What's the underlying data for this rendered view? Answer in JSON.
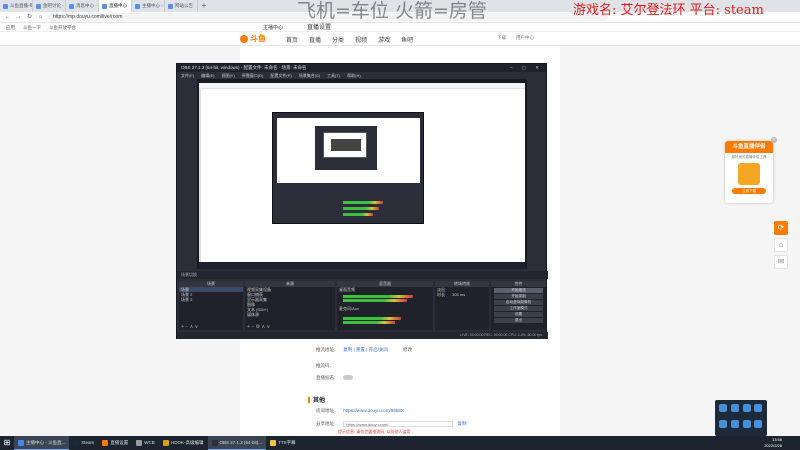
{
  "browser": {
    "tabs": [
      {
        "label": "斗鱼直播-每个人的直播平台"
      },
      {
        "label": "鱼吧讨论 - 斗鱼"
      },
      {
        "label": "消息中心 - 斗鱼"
      },
      {
        "label": "直播中心",
        "active": true
      },
      {
        "label": "主播中心 - 斗鱼"
      },
      {
        "label": "网站公告"
      }
    ],
    "url": "https://mp.douyu.com/live/room",
    "bookmarks": [
      "应用",
      "斗鱼一下",
      "斗鱼开放平台"
    ]
  },
  "overlay": {
    "left_text": "飞机=车位  火箭=房管",
    "right_text": "游戏名: 艾尔登法环  平台: steam"
  },
  "douyu": {
    "logo": "斗鱼",
    "nav": [
      "首页",
      "直播",
      "分类",
      "视频",
      "游戏",
      "鱼吧"
    ],
    "nav_right": [
      "下载",
      "用户中心"
    ],
    "side_title": "主播中心",
    "page_label": "直播设置",
    "fields": [
      {
        "label": "推流地址:",
        "value": "复制 | 重置 | 开启/关闭",
        "extra": "修改"
      },
      {
        "label": "推流码:",
        "value": ""
      },
      {
        "label": "直播标志:",
        "value": ""
      }
    ],
    "section_other": "其他",
    "room_link_label": "房间地址:",
    "room_link": "https://www.douyu.com/9958X",
    "share_label": "分享地址:",
    "share_link": "https://www.douyu.com/...",
    "share_btn": "复制",
    "warning": "提示信息: 请勿泄露推流码, 以防他人盗用"
  },
  "promo": {
    "title": "斗鱼直播伴侣",
    "subtitle": "超好用的直播伴侣工具",
    "button": "立即下载"
  },
  "obs": {
    "title": "OBS 27.1.3 (64-bit, windows) - 配置文件: 未命名 - 场景: 未命名",
    "menu": [
      "文件(F)",
      "编辑(E)",
      "视图(V)",
      "停靠窗口(D)",
      "配置文件(P)",
      "场景集合(S)",
      "工具(T)",
      "帮助(H)"
    ],
    "tabs_line": "场景切换",
    "docks": {
      "scenes": {
        "title": "场景",
        "items": [
          "场景",
          "场景 2",
          "场景 3"
        ]
      },
      "sources": {
        "title": "来源",
        "items": [
          "视频采集设备",
          "窗口捕获",
          "显示器采集",
          "图像",
          "文本 (GDI+)",
          "媒体源"
        ]
      },
      "mixer": {
        "title": "混音器",
        "channels": [
          "桌面音频",
          "麦克风/Aux"
        ]
      },
      "transitions": {
        "title": "转场特效",
        "type": "淡出",
        "duration_label": "时长",
        "duration": "300 ms"
      },
      "controls": {
        "title": "控件",
        "buttons": [
          "开始推流",
          "开始录制",
          "启动虚拟摄像机",
          "工作室模式",
          "设置",
          "退出"
        ]
      }
    },
    "status": "LIVE: 00:00:00   REC: 00:00:00   CPU: 3.4%, 60.00 fps"
  },
  "taskbar": {
    "items": [
      "主播中心 - 斗鱼直...",
      "Steam",
      "直播设置",
      "WCB",
      "HOOK-高级编辑",
      "OBS 27.1.3 (64-bit)...",
      "TTS字幕"
    ],
    "time": "13:56",
    "date": "2022/2/26"
  }
}
